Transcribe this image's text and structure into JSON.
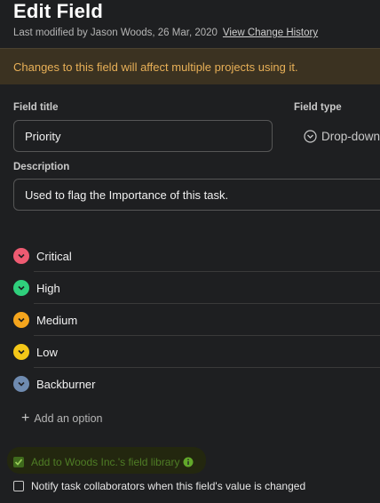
{
  "header": {
    "title": "Edit Field",
    "modified_text": "Last modified by Jason Woods, 26 Mar, 2020",
    "history_link": "View Change History"
  },
  "warning": {
    "text": "Changes to this field will affect multiple projects using it."
  },
  "form": {
    "title_label": "Field title",
    "title_value": "Priority",
    "type_label": "Field type",
    "type_value": "Drop-down",
    "description_label": "Description",
    "description_value": "Used to flag the Importance of this task."
  },
  "options": [
    {
      "label": "Critical",
      "color": "#ee5b72"
    },
    {
      "label": "High",
      "color": "#2fcf7c"
    },
    {
      "label": "Medium",
      "color": "#f5a51d"
    },
    {
      "label": "Low",
      "color": "#f4c718"
    },
    {
      "label": "Backburner",
      "color": "#6f8bb0"
    }
  ],
  "add_option_label": "Add an option",
  "library_checkbox": {
    "label": "Add to Woods Inc.'s field library",
    "checked": true,
    "color": "#4a7a22"
  },
  "notify_checkbox": {
    "label": "Notify task collaborators when this field's value is changed",
    "checked": false
  }
}
